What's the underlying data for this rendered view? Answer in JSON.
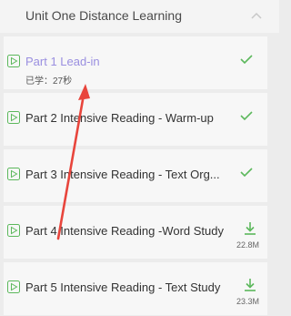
{
  "header": {
    "title": "Unit One Distance Learning",
    "chevron_icon": "chevron-up-icon"
  },
  "items": [
    {
      "label": "Part 1 Lead-in",
      "subtext": "已学：27秒",
      "status": "completed",
      "active": true
    },
    {
      "label": "Part 2 Intensive Reading - Warm-up",
      "status": "completed"
    },
    {
      "label": "Part 3 Intensive Reading - Text Org...",
      "status": "completed"
    },
    {
      "label": "Part 4 Intensive Reading -Word Study",
      "status": "download",
      "size": "22.8M"
    },
    {
      "label": "Part 5 Intensive Reading - Text Study",
      "status": "download",
      "size": "23.3M"
    }
  ],
  "colors": {
    "accent_green": "#5cb85c",
    "active_purple": "#9a8fe0",
    "annotation_red": "#e8453c"
  }
}
